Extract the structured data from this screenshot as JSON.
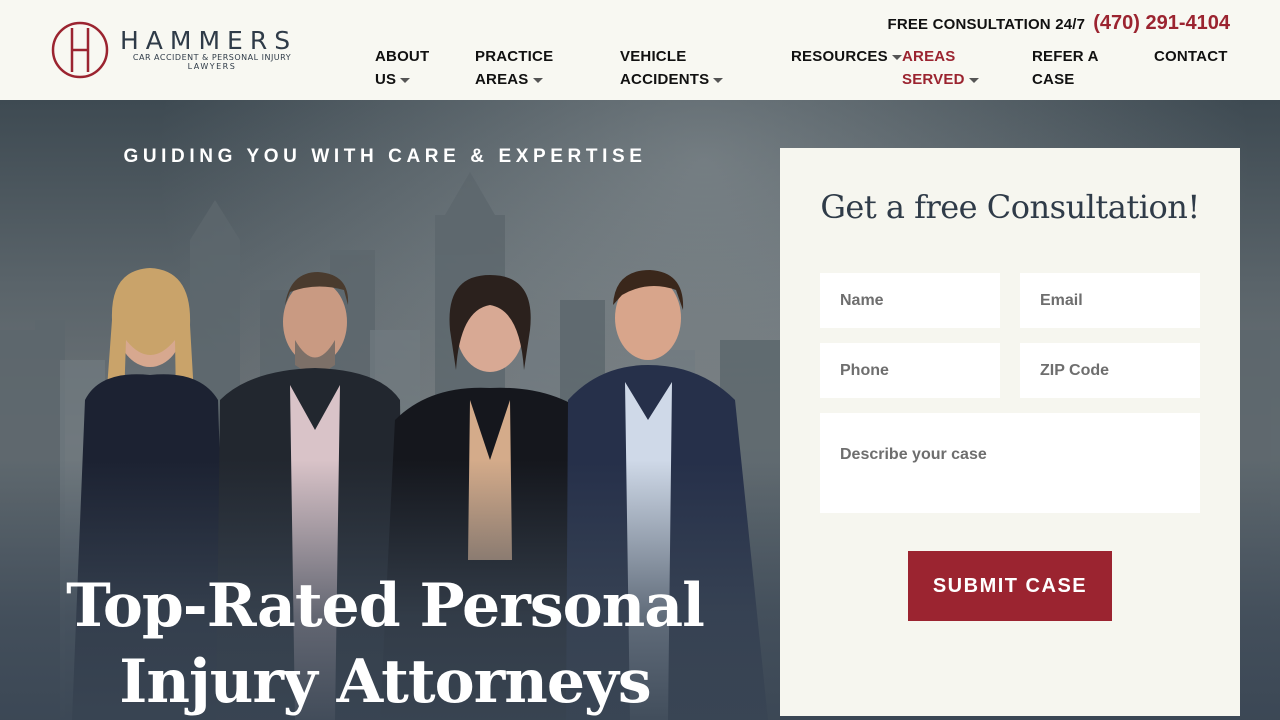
{
  "brand": {
    "name": "HAMMERS",
    "subtitle_line1": "CAR ACCIDENT & PERSONAL INJURY",
    "subtitle_line2": "LAWYERS",
    "accent_color": "#9b2430",
    "logo_icon": "hammers-monogram-logo"
  },
  "header": {
    "consultation_label": "FREE CONSULTATION 24/7",
    "phone": "(470) 291-4104"
  },
  "nav": {
    "about": {
      "line1": "ABOUT",
      "line2": "US",
      "has_dropdown": true
    },
    "practice": {
      "line1": "PRACTICE",
      "line2": "AREAS",
      "has_dropdown": true
    },
    "vehicle": {
      "line1": "VEHICLE",
      "line2": "ACCIDENTS",
      "has_dropdown": true
    },
    "resources": {
      "line1": "RESOURCES",
      "has_dropdown": true
    },
    "areas": {
      "line1": "AREAS",
      "line2": "SERVED",
      "has_dropdown": true,
      "active": true
    },
    "refer": {
      "line1": "REFER A",
      "line2": "CASE"
    },
    "contact": {
      "line1": "CONTACT"
    }
  },
  "hero": {
    "tagline": "GUIDING YOU WITH CARE & EXPERTISE",
    "title_line1": "Top-Rated Personal",
    "title_line2": "Injury Attorneys"
  },
  "form": {
    "heading": "Get a free Consultation!",
    "name_placeholder": "Name",
    "email_placeholder": "Email",
    "phone_placeholder": "Phone",
    "zip_placeholder": "ZIP Code",
    "case_placeholder": "Describe your case",
    "submit_label": "SUBMIT CASE"
  }
}
